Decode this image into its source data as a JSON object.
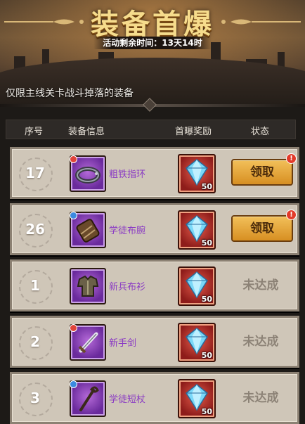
{
  "banner": {
    "title": "装备首爆",
    "timer_label": "活动剩余时间：",
    "timer_value": "13天14时",
    "subtitle": "仅限主线关卡战斗掉落的装备"
  },
  "table": {
    "headers": [
      "序号",
      "装备信息",
      "首曝奖励",
      "状态"
    ],
    "rows": [
      {
        "index": "17",
        "item_name": "粗铁指环",
        "reward_count": "50",
        "status": "领取",
        "claimable": true
      },
      {
        "index": "26",
        "item_name": "学徒布腕",
        "reward_count": "50",
        "status": "领取",
        "claimable": true
      },
      {
        "index": "1",
        "item_name": "新兵布衫",
        "reward_count": "50",
        "status": "未达成",
        "claimable": false
      },
      {
        "index": "2",
        "item_name": "新手剑",
        "reward_count": "50",
        "status": "未达成",
        "claimable": false
      },
      {
        "index": "3",
        "item_name": "学徒短杖",
        "reward_count": "50",
        "status": "未达成",
        "claimable": false
      }
    ]
  },
  "alert_symbol": "!",
  "icons": {
    "items": [
      "ring-icon",
      "bracer-icon",
      "armor-icon",
      "sword-icon",
      "staff-icon"
    ],
    "reward": "diamond-icon"
  },
  "colors": {
    "title": "#f6dc8c",
    "item_name": "#8a3ac4",
    "claim_button": "#f2c05a",
    "reward_frame": "#b22a24",
    "item_frame": "#8a3ac4"
  }
}
